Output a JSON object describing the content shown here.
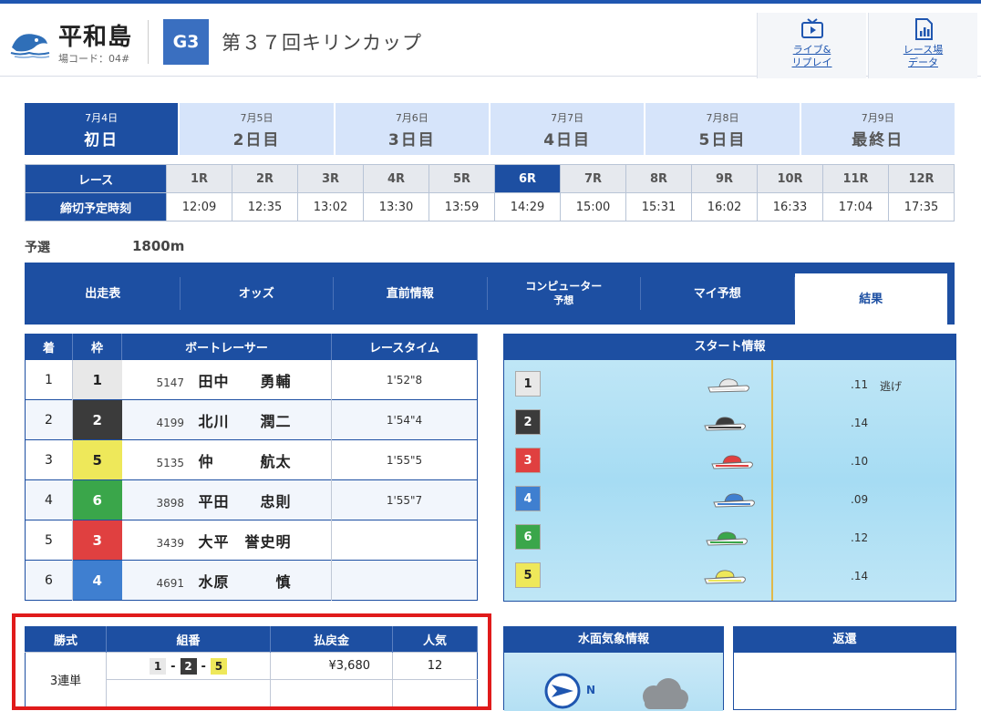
{
  "header": {
    "venue": "平和島",
    "venue_code": "場コード：04#",
    "grade": "G3",
    "race_title": "第３７回キリンカップ",
    "live_label_1": "ライブ&",
    "live_label_2": "リプレイ",
    "data_label_1": "レース場",
    "data_label_2": "データ"
  },
  "days": [
    {
      "date": "7月4日",
      "label": "初日",
      "active": true
    },
    {
      "date": "7月5日",
      "label": "2日目"
    },
    {
      "date": "7月6日",
      "label": "3日目"
    },
    {
      "date": "7月7日",
      "label": "4日目"
    },
    {
      "date": "7月8日",
      "label": "5日目"
    },
    {
      "date": "7月9日",
      "label": "最終日"
    }
  ],
  "races": {
    "row_label": "レース",
    "time_label": "締切予定時刻",
    "numbers": [
      "1R",
      "2R",
      "3R",
      "4R",
      "5R",
      "6R",
      "7R",
      "8R",
      "9R",
      "10R",
      "11R",
      "12R"
    ],
    "times": [
      "12:09",
      "12:35",
      "13:02",
      "13:30",
      "13:59",
      "14:29",
      "15:00",
      "15:31",
      "16:02",
      "16:33",
      "17:04",
      "17:35"
    ],
    "active": "6R"
  },
  "race_info": {
    "type": "予選",
    "distance": "1800m"
  },
  "tabs": [
    "出走表",
    "オッズ",
    "直前情報",
    "コンピューター予想",
    "マイ予想",
    "結果"
  ],
  "tabs_parts": {
    "computer_1": "コンピューター",
    "computer_2": "予想"
  },
  "result": {
    "headers": [
      "着",
      "枠",
      "ボートレーサー",
      "レースタイム"
    ],
    "rows": [
      {
        "rank": "1",
        "frame": "1",
        "reg": "5147",
        "name": "田中　　勇輔",
        "time": "1'52\"8"
      },
      {
        "rank": "2",
        "frame": "2",
        "reg": "4199",
        "name": "北川　　潤二",
        "time": "1'54\"4"
      },
      {
        "rank": "3",
        "frame": "5",
        "reg": "5135",
        "name": "仲　　　航太",
        "time": "1'55\"5"
      },
      {
        "rank": "4",
        "frame": "6",
        "reg": "3898",
        "name": "平田　　忠則",
        "time": "1'55\"7"
      },
      {
        "rank": "5",
        "frame": "3",
        "reg": "3439",
        "name": "大平　誉史明",
        "time": ""
      },
      {
        "rank": "6",
        "frame": "4",
        "reg": "4691",
        "name": "水原　　　慎",
        "time": ""
      }
    ]
  },
  "start": {
    "title": "スタート情報",
    "rows": [
      {
        "lane": "1",
        "st": ".11",
        "kimarite": "逃げ",
        "color": "#e8e8e8"
      },
      {
        "lane": "2",
        "st": ".14",
        "kimarite": "",
        "color": "#3b3b3b"
      },
      {
        "lane": "3",
        "st": ".10",
        "kimarite": "",
        "color": "#e04040"
      },
      {
        "lane": "4",
        "st": ".09",
        "kimarite": "",
        "color": "#3f7fd0"
      },
      {
        "lane": "6",
        "st": ".12",
        "kimarite": "",
        "color": "#3aa64a"
      },
      {
        "lane": "5",
        "st": ".14",
        "kimarite": "",
        "color": "#eee85a"
      }
    ]
  },
  "payout": {
    "headers": [
      "勝式",
      "組番",
      "払戻金",
      "人気"
    ],
    "bet_type": "3連単",
    "combo": [
      "1",
      "2",
      "5"
    ],
    "amount": "¥3,680",
    "popularity": "12"
  },
  "weather": {
    "title": "水面気象情報",
    "wind_dir": "N"
  },
  "henkan": {
    "title": "返還"
  }
}
